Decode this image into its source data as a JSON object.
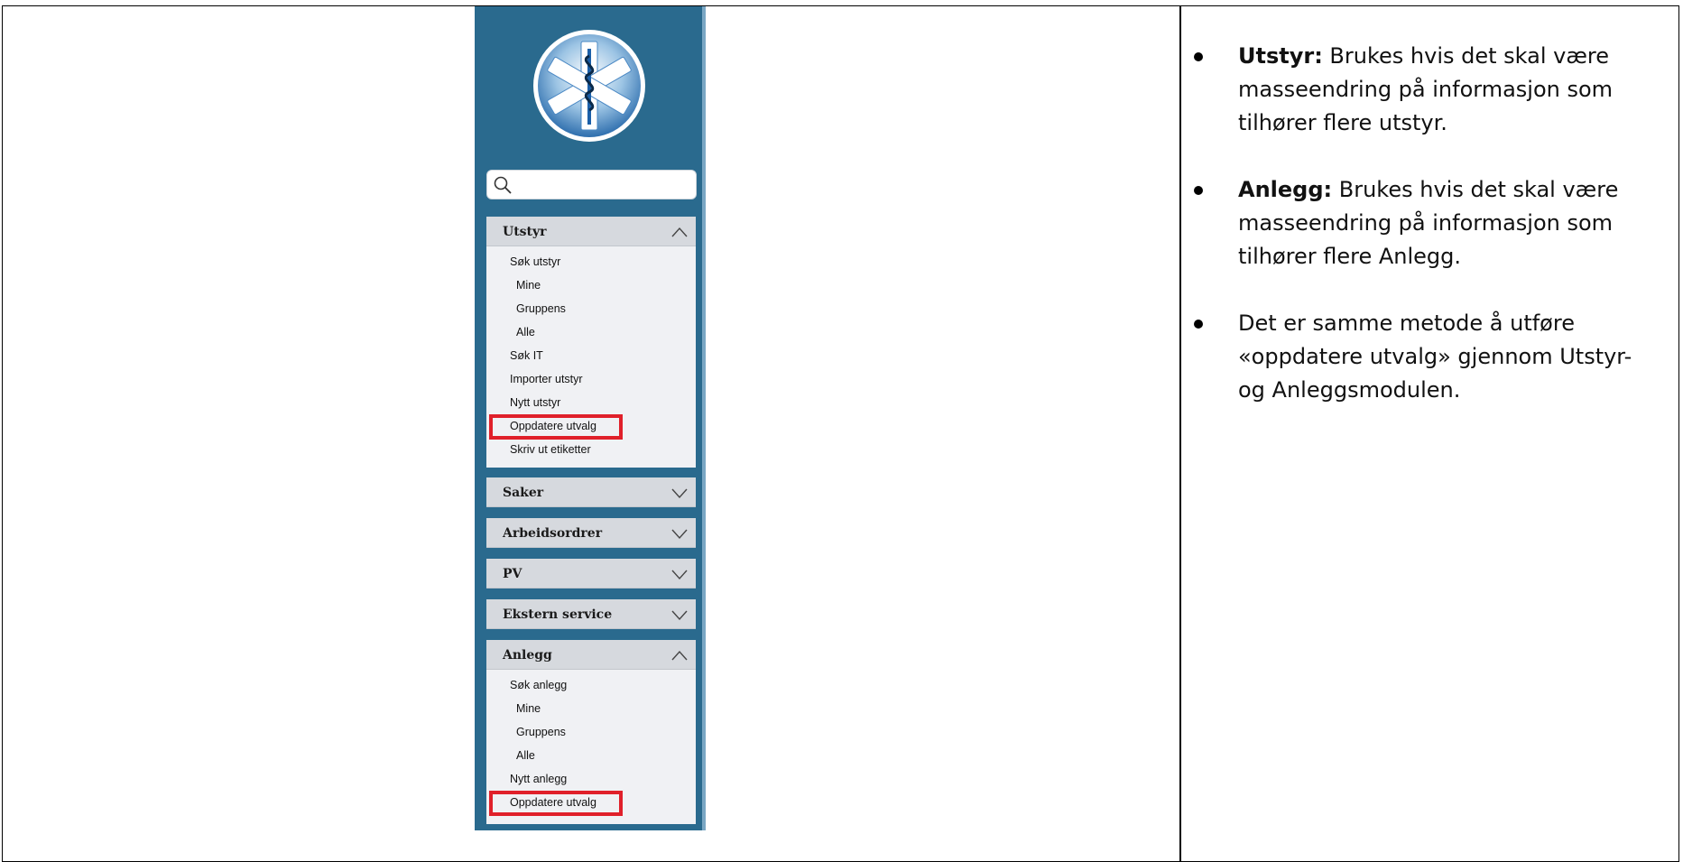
{
  "search": {
    "placeholder": ""
  },
  "sidebar": {
    "sections": [
      {
        "title": "Utstyr",
        "expanded": true,
        "items": [
          {
            "label": "Søk utstyr",
            "level": 1
          },
          {
            "label": "Mine",
            "level": 2
          },
          {
            "label": "Gruppens",
            "level": 2
          },
          {
            "label": "Alle",
            "level": 2
          },
          {
            "label": "Søk IT",
            "level": 1
          },
          {
            "label": "Importer utstyr",
            "level": 1
          },
          {
            "label": "Nytt utstyr",
            "level": 1
          },
          {
            "label": "Oppdatere utvalg",
            "level": 1,
            "highlighted": true
          },
          {
            "label": "Skriv ut etiketter",
            "level": 1
          }
        ]
      },
      {
        "title": "Saker",
        "expanded": false
      },
      {
        "title": "Arbeidsordrer",
        "expanded": false
      },
      {
        "title": "PV",
        "expanded": false
      },
      {
        "title": "Ekstern service",
        "expanded": false
      },
      {
        "title": "Anlegg",
        "expanded": true,
        "items": [
          {
            "label": "Søk anlegg",
            "level": 1
          },
          {
            "label": "Mine",
            "level": 2
          },
          {
            "label": "Gruppens",
            "level": 2
          },
          {
            "label": "Alle",
            "level": 2
          },
          {
            "label": "Nytt anlegg",
            "level": 1
          },
          {
            "label": "Oppdatere utvalg",
            "level": 1,
            "highlighted": true
          }
        ]
      }
    ]
  },
  "notes": [
    {
      "term": "Utstyr:",
      "text": " Brukes hvis det skal være masseendring på informasjon som tilhører flere utstyr."
    },
    {
      "term": "Anlegg:",
      "text": " Brukes hvis det skal være masseendring på informasjon som tilhører flere Anlegg."
    },
    {
      "term": "",
      "text": "Det er samme metode å utføre «oppdatere utvalg» gjennom Utstyr- og Anleggsmodulen."
    }
  ],
  "colors": {
    "sidebar": "#2a6a8e",
    "highlight": "#e0202a",
    "section_header": "#d6d9de"
  },
  "icons": {
    "logo": "star-of-life-icon",
    "search": "search-icon",
    "expanded": "chevron-up-icon",
    "collapsed": "chevron-down-icon"
  }
}
